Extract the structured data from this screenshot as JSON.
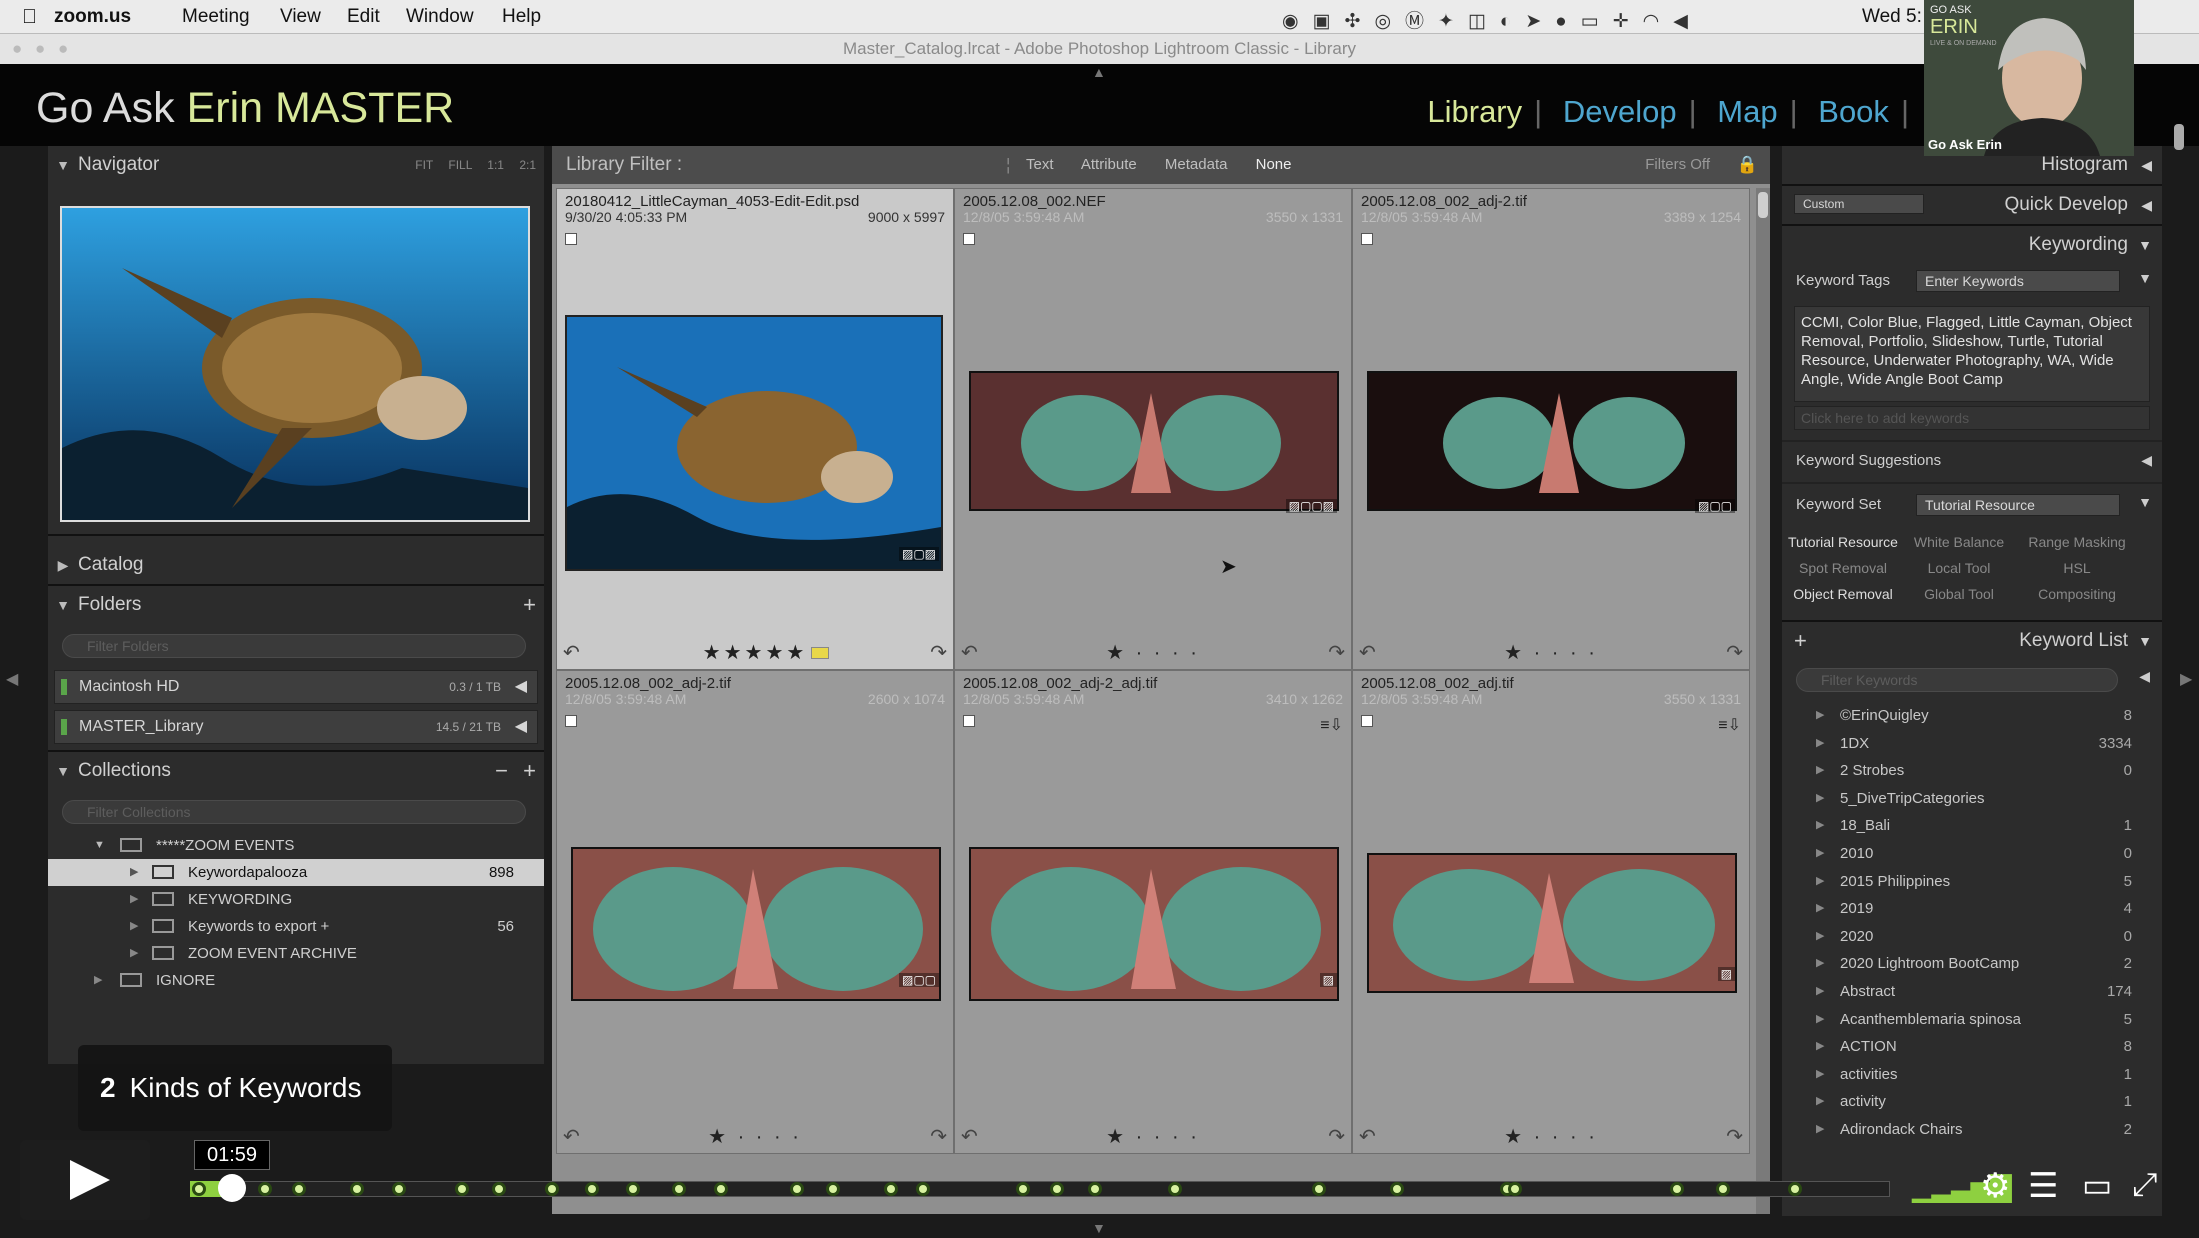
{
  "menubar": {
    "app": "zoom.us",
    "items": [
      "Meeting",
      "View",
      "Edit",
      "Window",
      "Help"
    ],
    "clock": "Wed 5:"
  },
  "window": {
    "title": "Master_Catalog.lrcat - Adobe Photoshop Lightroom Classic - Library"
  },
  "identity": {
    "brand_prefix": "Go Ask ",
    "brand_name": "Erin MASTER",
    "modules": [
      "Library",
      "Develop",
      "Map",
      "Book"
    ],
    "active_module": "Library"
  },
  "navigator": {
    "title": "Navigator",
    "zoom_options": [
      "FIT",
      "FILL",
      "1:1",
      "2:1"
    ]
  },
  "left_panels": {
    "catalog": "Catalog",
    "folders": "Folders",
    "folders_filter": "Filter Folders",
    "collections": "Collections",
    "collections_filter": "Filter Collections"
  },
  "folders": [
    {
      "name": "Macintosh HD",
      "size": "0.3 / 1 TB"
    },
    {
      "name": "MASTER_Library",
      "size": "14.5 / 21 TB"
    }
  ],
  "collections": [
    {
      "name": "*****ZOOM EVENTS",
      "count": "",
      "level": 1,
      "selected": false
    },
    {
      "name": "Keywordapalooza",
      "count": "898",
      "level": 2,
      "selected": true
    },
    {
      "name": "KEYWORDING",
      "count": "",
      "level": 2,
      "selected": false
    },
    {
      "name": "Keywords to export  +",
      "count": "56",
      "level": 2,
      "selected": false
    },
    {
      "name": "ZOOM EVENT ARCHIVE",
      "count": "",
      "level": 2,
      "selected": false
    },
    {
      "name": "IGNORE",
      "count": "",
      "level": 1,
      "selected": false
    }
  ],
  "library_filter": {
    "label": "Library Filter :",
    "options": [
      "Text",
      "Attribute",
      "Metadata",
      "None"
    ],
    "active": "None",
    "status": "Filters Off"
  },
  "grid": [
    {
      "name": "20180412_LittleCayman_4053-Edit-Edit.psd",
      "date": "9/30/20 4:05:33 PM",
      "dims": "9000 x 5997",
      "stars": "★★★★★",
      "selected": true
    },
    {
      "name": "2005.12.08_002.NEF",
      "date": "12/8/05 3:59:48 AM",
      "dims": "3550 x 1331",
      "stars": "★ · · · ·",
      "selected": false
    },
    {
      "name": "2005.12.08_002_adj-2.tif",
      "date": "12/8/05 3:59:48 AM",
      "dims": "3389 x 1254",
      "stars": "★ · · · ·",
      "selected": false
    },
    {
      "name": "2005.12.08_002_adj-2.tif",
      "date": "12/8/05 3:59:48 AM",
      "dims": "2600 x 1074",
      "stars": "★ · · · ·",
      "selected": false
    },
    {
      "name": "2005.12.08_002_adj-2_adj.tif",
      "date": "12/8/05 3:59:48 AM",
      "dims": "3410 x 1262",
      "stars": "★ · · · ·",
      "selected": false
    },
    {
      "name": "2005.12.08_002_adj.tif",
      "date": "12/8/05 3:59:48 AM",
      "dims": "3550 x 1331",
      "stars": "★ · · · ·",
      "selected": false
    }
  ],
  "right_panels": {
    "histogram": "Histogram",
    "quick_develop": "Quick Develop",
    "preset": "Custom",
    "keywording": "Keywording",
    "keyword_tags_label": "Keyword Tags",
    "keyword_tags_mode": "Enter Keywords",
    "keywords_text": "CCMI, Color Blue, Flagged, Little Cayman, Object Removal, Portfolio, Slideshow, Turtle, Tutorial Resource, Underwater Photography, WA, Wide Angle, Wide Angle Boot Camp",
    "add_keywords_placeholder": "Click here to add keywords",
    "keyword_suggestions": "Keyword Suggestions",
    "keyword_set_label": "Keyword Set",
    "keyword_set_value": "Tutorial Resource",
    "keyword_list": "Keyword List",
    "keyword_filter": "Filter Keywords"
  },
  "keyword_set": [
    "Tutorial Resource",
    "White Balance",
    "Range Masking",
    "Spot Removal",
    "Local Tool",
    "HSL",
    "Object Removal",
    "Global Tool",
    "Compositing"
  ],
  "keyword_list": [
    {
      "name": "©ErinQuigley",
      "count": "8"
    },
    {
      "name": "1DX",
      "count": "3334"
    },
    {
      "name": "2 Strobes",
      "count": "0"
    },
    {
      "name": "5_DiveTripCategories",
      "count": ""
    },
    {
      "name": "18_Bali",
      "count": "1"
    },
    {
      "name": "2010",
      "count": "0"
    },
    {
      "name": "2015 Philippines",
      "count": "5"
    },
    {
      "name": "2019",
      "count": "4"
    },
    {
      "name": "2020",
      "count": "0"
    },
    {
      "name": "2020 Lightroom BootCamp",
      "count": "2"
    },
    {
      "name": "Abstract",
      "count": "174"
    },
    {
      "name": "Acanthemblemaria spinosa",
      "count": "5"
    },
    {
      "name": "ACTION",
      "count": "8"
    },
    {
      "name": "activities",
      "count": "1"
    },
    {
      "name": "activity",
      "count": "1"
    },
    {
      "name": "Adirondack Chairs",
      "count": "2"
    }
  ],
  "video": {
    "chapter_number": "2",
    "chapter_title": "Kinds of Keywords",
    "time": "01:59",
    "webcam_label": "Go Ask Erin",
    "logo_line1": "GO ASK",
    "logo_line2": "ERIN",
    "logo_line3": "LIVE & ON DEMAND"
  }
}
